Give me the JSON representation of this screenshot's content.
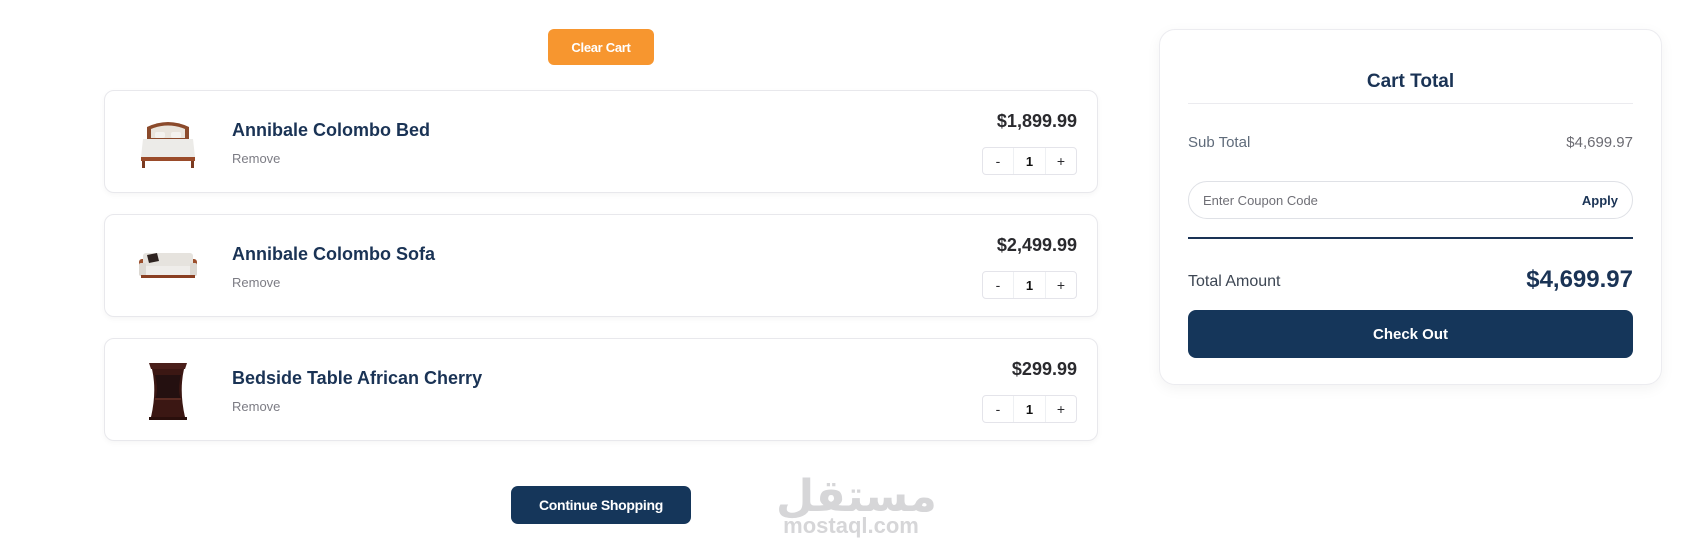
{
  "actions": {
    "clear_cart_label": "Clear Cart",
    "continue_label": "Continue Shopping",
    "accent_color": "#f7962f",
    "primary_color": "#15365a"
  },
  "cart": {
    "remove_label": "Remove",
    "items": [
      {
        "name": "Annibale Colombo Bed",
        "price": "$1,899.99",
        "qty": "1",
        "decrement": "-",
        "increment": "+",
        "image_icon": "bed-image"
      },
      {
        "name": "Annibale Colombo Sofa",
        "price": "$2,499.99",
        "qty": "1",
        "decrement": "-",
        "increment": "+",
        "image_icon": "sofa-image"
      },
      {
        "name": "Bedside Table African Cherry",
        "price": "$299.99",
        "qty": "1",
        "decrement": "-",
        "increment": "+",
        "image_icon": "bedside-table-image"
      }
    ]
  },
  "summary": {
    "title": "Cart Total",
    "subtotal_label": "Sub Total",
    "subtotal_value": "$4,699.97",
    "coupon_placeholder": "Enter Coupon Code",
    "apply_label": "Apply",
    "total_label": "Total Amount",
    "total_value": "$4,699.97",
    "checkout_label": "Check Out"
  },
  "watermark": {
    "arabic": "مستقل",
    "latin": "mostaql.com"
  }
}
